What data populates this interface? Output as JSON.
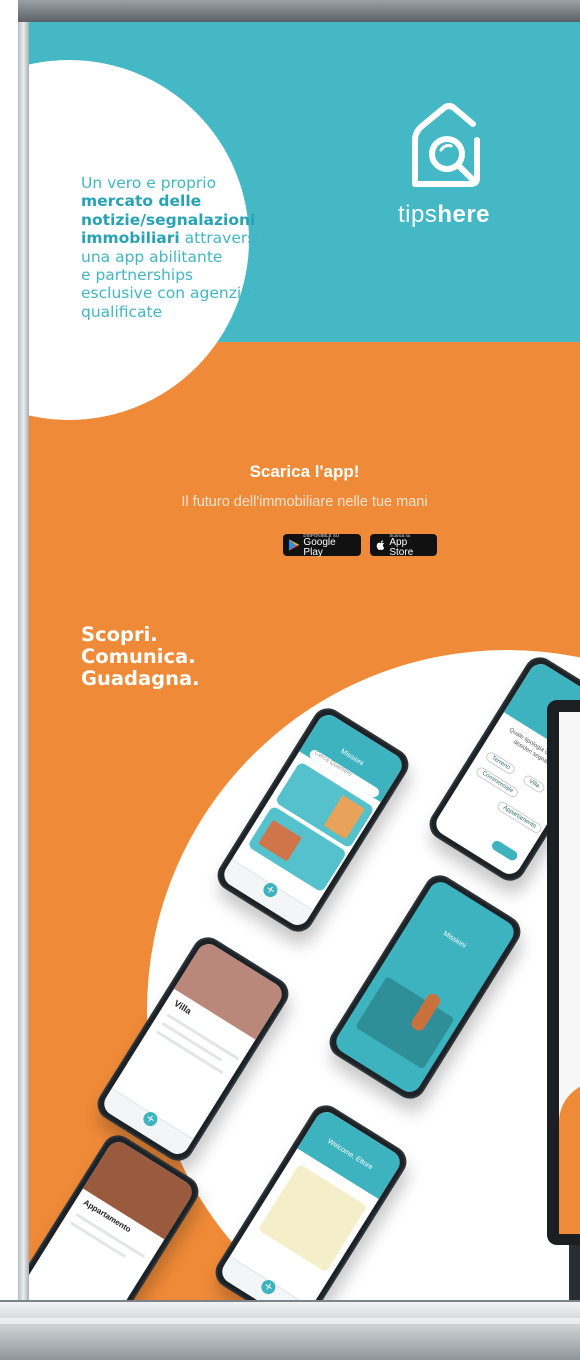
{
  "brand": {
    "name_light": "tips",
    "name_bold": "here",
    "logo_icon": "house-with-magnifier-icon",
    "color_teal": "#45b8c5",
    "color_orange": "#ef8a38"
  },
  "intro": {
    "line1": "Un vero e proprio",
    "bold1": "mercato delle",
    "bold2": "notizie/segnalazioni",
    "bold3": "immobiliari",
    "rest3": " attraverso",
    "line5": "una app abilitante",
    "line6": "e partnerships",
    "line7": "esclusive con agenzie",
    "line8": "qualificate"
  },
  "cta": {
    "title": "Scarica l'app!",
    "subtitle": "Il futuro dell'immobiliare nelle tue mani",
    "google_small": "DISPONIBILE SU",
    "google_big": "Google Play",
    "apple_small": "Scarica su",
    "apple_big": "App Store"
  },
  "slogan": {
    "line1": "Scopri.",
    "line2": "Comunica.",
    "line3": "Guadagna."
  },
  "phones": {
    "p1_title": "Missioni",
    "p1_search": "Cerca Quartiere",
    "p2_question": "Quale tipologia di immobile desideri segnalare?",
    "p2_opt1": "Terreno",
    "p2_opt2": "Commerciale",
    "p2_opt3": "Villa",
    "p2_opt4": "Appartamento",
    "p3_title": "Missioni",
    "p4_title": "Villa",
    "p5_title": "Welcome, Ettore",
    "p6_title": "Appartamento"
  }
}
